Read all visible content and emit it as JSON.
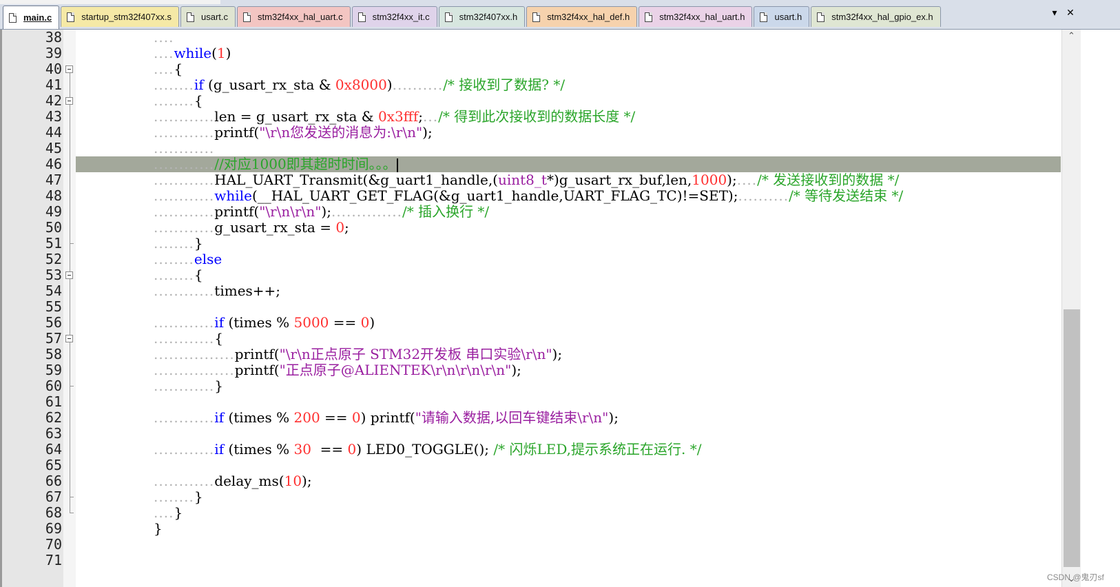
{
  "tabs": [
    {
      "label": "main.c",
      "color": "#ffffff",
      "active": true
    },
    {
      "label": "startup_stm32f407xx.s",
      "color": "#f5e9a6",
      "active": false
    },
    {
      "label": "usart.c",
      "color": "#dfe4d1",
      "active": false
    },
    {
      "label": "stm32f4xx_hal_uart.c",
      "color": "#f3c5c2",
      "active": false
    },
    {
      "label": "stm32f4xx_it.c",
      "color": "#dfd3ea",
      "active": false
    },
    {
      "label": "stm32f407xx.h",
      "color": "#d7e6df",
      "active": false
    },
    {
      "label": "stm32f4xx_hal_def.h",
      "color": "#f6d2ad",
      "active": false
    },
    {
      "label": "stm32f4xx_hal_uart.h",
      "color": "#ead2e7",
      "active": false
    },
    {
      "label": "usart.h",
      "color": "#cbd8ea",
      "active": false
    },
    {
      "label": "stm32f4xx_hal_gpio_ex.h",
      "color": "#dfe6d3",
      "active": false
    }
  ],
  "tabbar": {
    "dropdown": "▾",
    "close": "✕"
  },
  "editor": {
    "highlight_line": 46,
    "colors": {
      "keyword": "#0000ff",
      "number": "#ff3030",
      "string": "#9a1fa0",
      "comment": "#2aa52a",
      "highlight": "#a3a89b"
    },
    "folds": [
      {
        "start": 40,
        "end": 68
      },
      {
        "start": 42,
        "end": 51
      },
      {
        "start": 53,
        "end": 67
      },
      {
        "start": 57,
        "end": 60
      }
    ],
    "lines": [
      {
        "n": "38",
        "segs": [
          {
            "t": "....",
            "c": "dots"
          }
        ]
      },
      {
        "n": "39",
        "segs": [
          {
            "t": "....",
            "c": "dots"
          },
          {
            "t": "while",
            "c": "kw"
          },
          {
            "t": "(",
            "c": ""
          },
          {
            "t": "1",
            "c": "num"
          },
          {
            "t": ")",
            "c": ""
          }
        ]
      },
      {
        "n": "40",
        "segs": [
          {
            "t": "....",
            "c": "dots"
          },
          {
            "t": "{",
            "c": ""
          }
        ]
      },
      {
        "n": "41",
        "segs": [
          {
            "t": "........",
            "c": "dots"
          },
          {
            "t": "if",
            "c": "kw"
          },
          {
            "t": " (g_usart_rx_sta & ",
            "c": ""
          },
          {
            "t": "0x8000",
            "c": "num"
          },
          {
            "t": ")",
            "c": ""
          },
          {
            "t": "..........",
            "c": "dots"
          },
          {
            "t": "/* 接收到了数据? */",
            "c": "cm"
          }
        ]
      },
      {
        "n": "42",
        "segs": [
          {
            "t": "........",
            "c": "dots"
          },
          {
            "t": "{",
            "c": ""
          }
        ]
      },
      {
        "n": "43",
        "segs": [
          {
            "t": "............",
            "c": "dots"
          },
          {
            "t": "len = g_usart_rx_sta & ",
            "c": ""
          },
          {
            "t": "0x3fff",
            "c": "num"
          },
          {
            "t": ";",
            "c": ""
          },
          {
            "t": "...",
            "c": "dots"
          },
          {
            "t": "/* 得到此次接收到的数据长度 */",
            "c": "cm"
          }
        ]
      },
      {
        "n": "44",
        "segs": [
          {
            "t": "............",
            "c": "dots"
          },
          {
            "t": "printf(",
            "c": ""
          },
          {
            "t": "\"\\r\\n您发送的消息为:\\r\\n\"",
            "c": "str"
          },
          {
            "t": ");",
            "c": ""
          }
        ]
      },
      {
        "n": "45",
        "segs": [
          {
            "t": "............",
            "c": "dots"
          }
        ]
      },
      {
        "n": "46",
        "segs": [
          {
            "t": "............",
            "c": "dots"
          },
          {
            "t": "//对应1000即其超时时间。。。",
            "c": "cm"
          }
        ]
      },
      {
        "n": "47",
        "segs": [
          {
            "t": "............",
            "c": "dots"
          },
          {
            "t": "HAL_UART_Transmit(&g_uart1_handle,(",
            "c": ""
          },
          {
            "t": "uint8_t",
            "c": "str"
          },
          {
            "t": "*)g_usart_rx_buf,len,",
            "c": ""
          },
          {
            "t": "1000",
            "c": "num"
          },
          {
            "t": ");",
            "c": ""
          },
          {
            "t": "....",
            "c": "dots"
          },
          {
            "t": "/* 发送接收到的数据 */",
            "c": "cm"
          }
        ]
      },
      {
        "n": "48",
        "segs": [
          {
            "t": "............",
            "c": "dots"
          },
          {
            "t": "while",
            "c": "kw"
          },
          {
            "t": "(__HAL_UART_GET_FLAG(&g_uart1_handle,UART_FLAG_TC)!=SET);",
            "c": ""
          },
          {
            "t": "..........",
            "c": "dots"
          },
          {
            "t": "/* 等待发送结束 */",
            "c": "cm"
          }
        ]
      },
      {
        "n": "49",
        "segs": [
          {
            "t": "............",
            "c": "dots"
          },
          {
            "t": "printf(",
            "c": ""
          },
          {
            "t": "\"\\r\\n\\r\\n\"",
            "c": "str"
          },
          {
            "t": ");",
            "c": ""
          },
          {
            "t": "..............",
            "c": "dots"
          },
          {
            "t": "/* 插入换行 */",
            "c": "cm"
          }
        ]
      },
      {
        "n": "50",
        "segs": [
          {
            "t": "............",
            "c": "dots"
          },
          {
            "t": "g_usart_rx_sta = ",
            "c": ""
          },
          {
            "t": "0",
            "c": "num"
          },
          {
            "t": ";",
            "c": ""
          }
        ]
      },
      {
        "n": "51",
        "segs": [
          {
            "t": "........",
            "c": "dots"
          },
          {
            "t": "}",
            "c": ""
          }
        ]
      },
      {
        "n": "52",
        "segs": [
          {
            "t": "........",
            "c": "dots"
          },
          {
            "t": "else",
            "c": "kw"
          }
        ]
      },
      {
        "n": "53",
        "segs": [
          {
            "t": "........",
            "c": "dots"
          },
          {
            "t": "{",
            "c": ""
          }
        ]
      },
      {
        "n": "54",
        "segs": [
          {
            "t": "............",
            "c": "dots"
          },
          {
            "t": "times++;",
            "c": ""
          }
        ]
      },
      {
        "n": "55",
        "segs": []
      },
      {
        "n": "56",
        "segs": [
          {
            "t": "............",
            "c": "dots"
          },
          {
            "t": "if",
            "c": "kw"
          },
          {
            "t": " (times % ",
            "c": ""
          },
          {
            "t": "5000",
            "c": "num"
          },
          {
            "t": " == ",
            "c": ""
          },
          {
            "t": "0",
            "c": "num"
          },
          {
            "t": ")",
            "c": ""
          }
        ]
      },
      {
        "n": "57",
        "segs": [
          {
            "t": "............",
            "c": "dots"
          },
          {
            "t": "{",
            "c": ""
          }
        ]
      },
      {
        "n": "58",
        "segs": [
          {
            "t": "................",
            "c": "dots"
          },
          {
            "t": "printf(",
            "c": ""
          },
          {
            "t": "\"\\r\\n正点原子 STM32开发板 串口实验\\r\\n\"",
            "c": "str"
          },
          {
            "t": ");",
            "c": ""
          }
        ]
      },
      {
        "n": "59",
        "segs": [
          {
            "t": "................",
            "c": "dots"
          },
          {
            "t": "printf(",
            "c": ""
          },
          {
            "t": "\"正点原子@ALIENTEK\\r\\n\\r\\n\\r\\n\"",
            "c": "str"
          },
          {
            "t": ");",
            "c": ""
          }
        ]
      },
      {
        "n": "60",
        "segs": [
          {
            "t": "............",
            "c": "dots"
          },
          {
            "t": "}",
            "c": ""
          }
        ]
      },
      {
        "n": "61",
        "segs": []
      },
      {
        "n": "62",
        "segs": [
          {
            "t": "............",
            "c": "dots"
          },
          {
            "t": "if",
            "c": "kw"
          },
          {
            "t": " (times % ",
            "c": ""
          },
          {
            "t": "200",
            "c": "num"
          },
          {
            "t": " == ",
            "c": ""
          },
          {
            "t": "0",
            "c": "num"
          },
          {
            "t": ") printf(",
            "c": ""
          },
          {
            "t": "\"请输入数据,以回车键结束\\r\\n\"",
            "c": "str"
          },
          {
            "t": ");",
            "c": ""
          }
        ]
      },
      {
        "n": "63",
        "segs": []
      },
      {
        "n": "64",
        "segs": [
          {
            "t": "............",
            "c": "dots"
          },
          {
            "t": "if",
            "c": "kw"
          },
          {
            "t": " (times % ",
            "c": ""
          },
          {
            "t": "30",
            "c": "num"
          },
          {
            "t": "  == ",
            "c": ""
          },
          {
            "t": "0",
            "c": "num"
          },
          {
            "t": ") LED0_TOGGLE(); ",
            "c": ""
          },
          {
            "t": "/* 闪烁LED,提示系统正在运行. */",
            "c": "cm"
          }
        ]
      },
      {
        "n": "65",
        "segs": []
      },
      {
        "n": "66",
        "segs": [
          {
            "t": "............",
            "c": "dots"
          },
          {
            "t": "delay_ms(",
            "c": ""
          },
          {
            "t": "10",
            "c": "num"
          },
          {
            "t": ");",
            "c": ""
          }
        ]
      },
      {
        "n": "67",
        "segs": [
          {
            "t": "........",
            "c": "dots"
          },
          {
            "t": "}",
            "c": ""
          }
        ]
      },
      {
        "n": "68",
        "segs": [
          {
            "t": "....",
            "c": "dots"
          },
          {
            "t": "}",
            "c": ""
          }
        ]
      },
      {
        "n": "69",
        "segs": [
          {
            "t": "}",
            "c": ""
          }
        ]
      },
      {
        "n": "70",
        "segs": []
      },
      {
        "n": "71",
        "segs": []
      }
    ]
  },
  "scrollbar": {
    "up_icon": "chevron-up-icon",
    "down_icon": "chevron-down-icon",
    "up_glyph": "⌃",
    "down_glyph": "⌄",
    "position": 0.5
  },
  "watermark": "CSDN @鬼刃sf"
}
